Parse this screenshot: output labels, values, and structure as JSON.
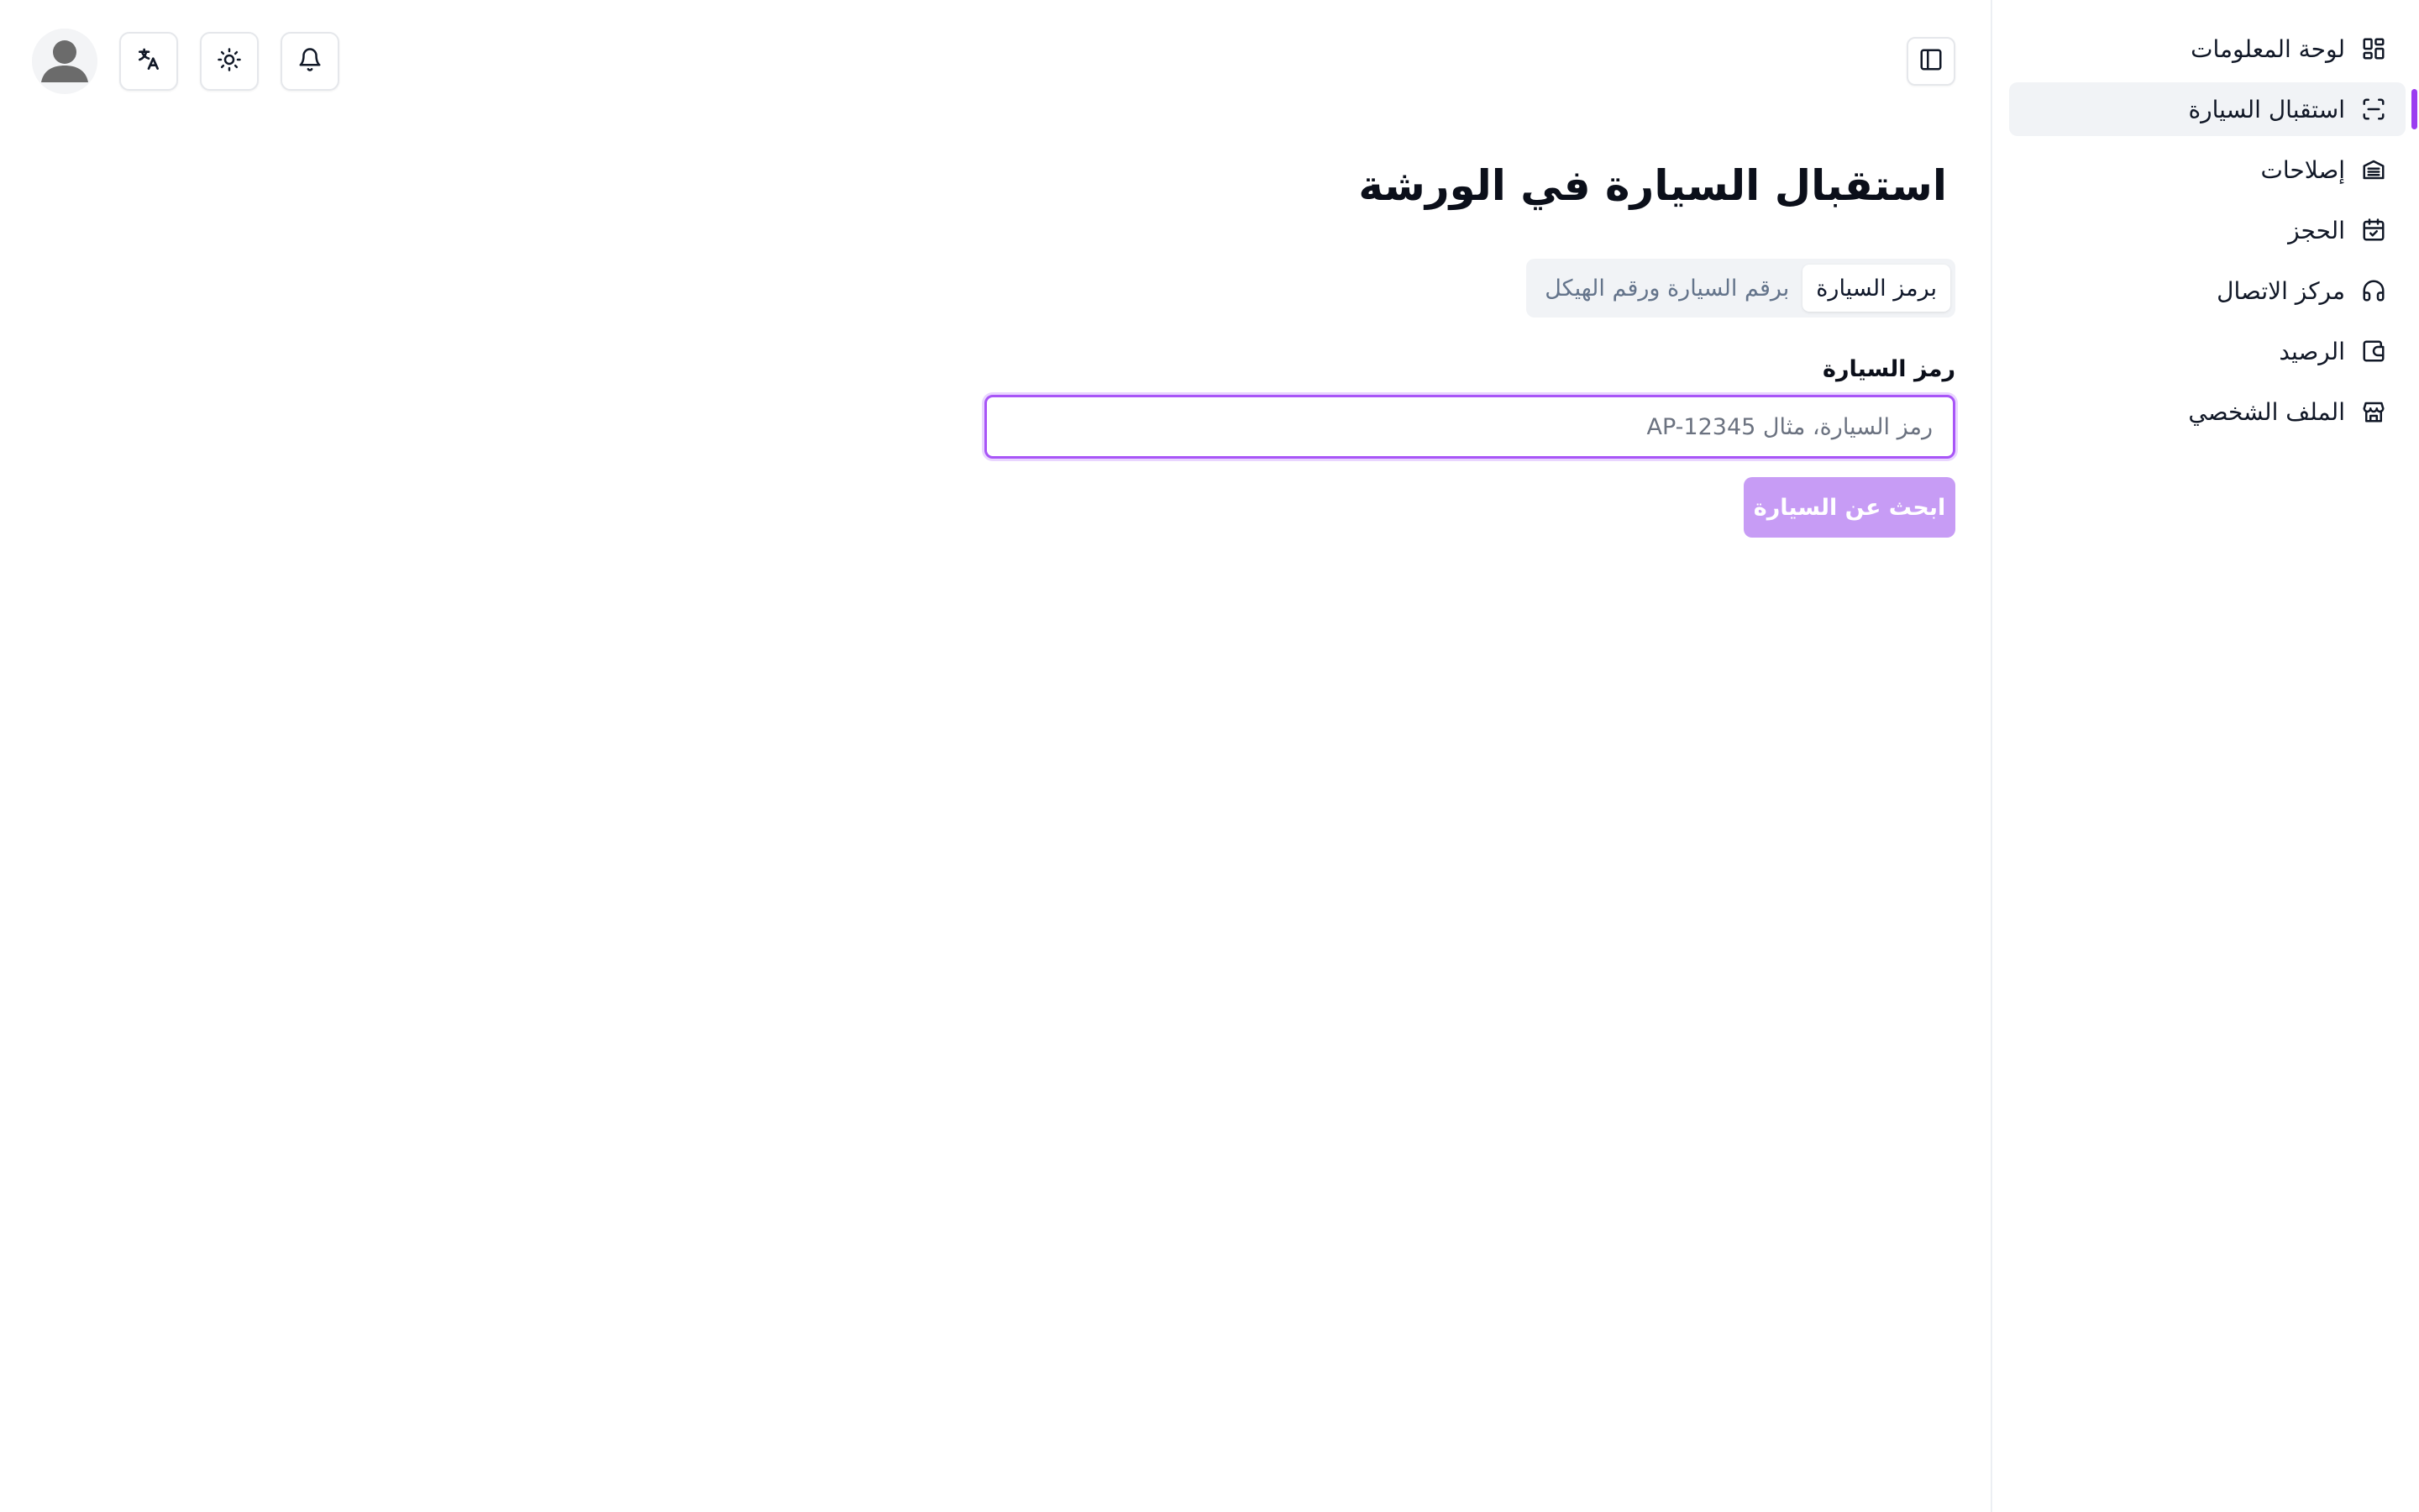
{
  "sidebar": {
    "items": [
      {
        "label": "لوحة المعلومات",
        "icon": "dashboard-grid-icon"
      },
      {
        "label": "استقبال السيارة",
        "icon": "scan-icon",
        "active": true
      },
      {
        "label": "إصلاحات",
        "icon": "repairs-icon"
      },
      {
        "label": "الحجز",
        "icon": "calendar-icon"
      },
      {
        "label": "مركز الاتصال",
        "icon": "headset-icon"
      },
      {
        "label": "الرصيد",
        "icon": "wallet-icon"
      },
      {
        "label": "الملف الشخصي",
        "icon": "store-icon"
      }
    ],
    "active_indicator_color": "#9b3cf0"
  },
  "topbar": {
    "icons": [
      "avatar-icon",
      "translate-icon",
      "sun-icon",
      "bell-icon",
      "sidebar-toggle-icon"
    ]
  },
  "main": {
    "title": "استقبال السيارة في الورشة",
    "tabs": [
      {
        "label": "برمز السيارة",
        "active": true
      },
      {
        "label": "برقم السيارة ورقم الهيكل",
        "active": false
      }
    ],
    "field_label": "رمز السيارة",
    "search": {
      "value": "",
      "placeholder": "رمز السيارة، مثال AP-12345"
    },
    "submit_label": "ابحث عن السيارة"
  },
  "colors": {
    "accent": "#a855f7",
    "button_disabled": "#c79cf5",
    "active_nav_bg": "#f1f3f6"
  }
}
